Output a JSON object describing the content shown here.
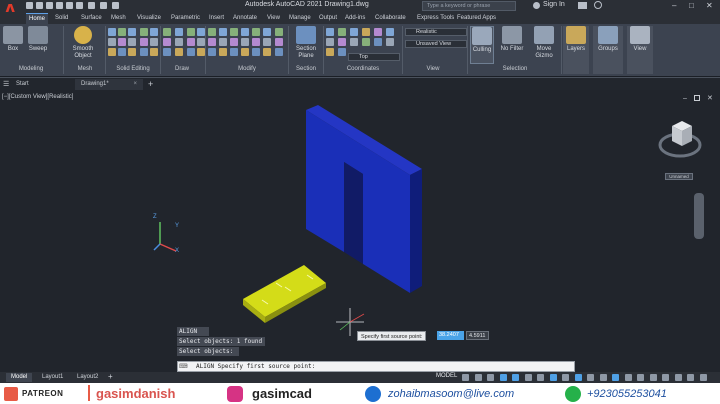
{
  "app": {
    "title": "Autodesk AutoCAD 2021   Drawing1.dwg",
    "search_placeholder": "Type a keyword or phrase",
    "signin": "Sign In"
  },
  "ribbon_tabs": [
    "Home",
    "Solid",
    "Surface",
    "Mesh",
    "Visualize",
    "Parametric",
    "Insert",
    "Annotate",
    "View",
    "Manage",
    "Output",
    "Add-ins",
    "Collaborate",
    "Express Tools",
    "Featured Apps"
  ],
  "ribbon": {
    "box": "Box",
    "sweep": "Sweep",
    "smooth_object": "Smooth Object",
    "section_plane": "Section Plane",
    "culling": "Culling",
    "no_filter": "No Filter",
    "move_gizmo": "Move Gizmo",
    "layers": "Layers",
    "groups": "Groups",
    "view": "View",
    "visual_style": "Realistic",
    "saved_view": "Unsaved View",
    "ucs": "Top",
    "panels": [
      "Modeling",
      "Mesh",
      "Solid Editing",
      "Draw",
      "Modify",
      "Section",
      "Coordinates",
      "View",
      "Selection"
    ]
  },
  "file_tabs": [
    "Start",
    "Drawing1*"
  ],
  "viewport": {
    "label": "[−][Custom View][Realistic]",
    "viewcube_label": "Unnamed"
  },
  "command": {
    "history": [
      "ALIGN",
      "Select objects: 1 found",
      "Select objects:"
    ],
    "prompt": "ALIGN Specify first source point:",
    "tooltip": "Specify first source point:",
    "coord_x": "38.2407",
    "coord_y": "4.5911"
  },
  "layout_tabs": [
    "Model",
    "Layout1",
    "Layout2"
  ],
  "status": {
    "model": "MODEL"
  },
  "footer": {
    "patreon": "PATREON",
    "patreon_handle": "gasimdanish",
    "instagram": "gasimcad",
    "email": "zohaibmasoom@live.com",
    "phone": "+923055253041"
  },
  "colors": {
    "wall": "#1a2fb8",
    "plate": "#c8d012",
    "accent": "#4aa3e8"
  }
}
